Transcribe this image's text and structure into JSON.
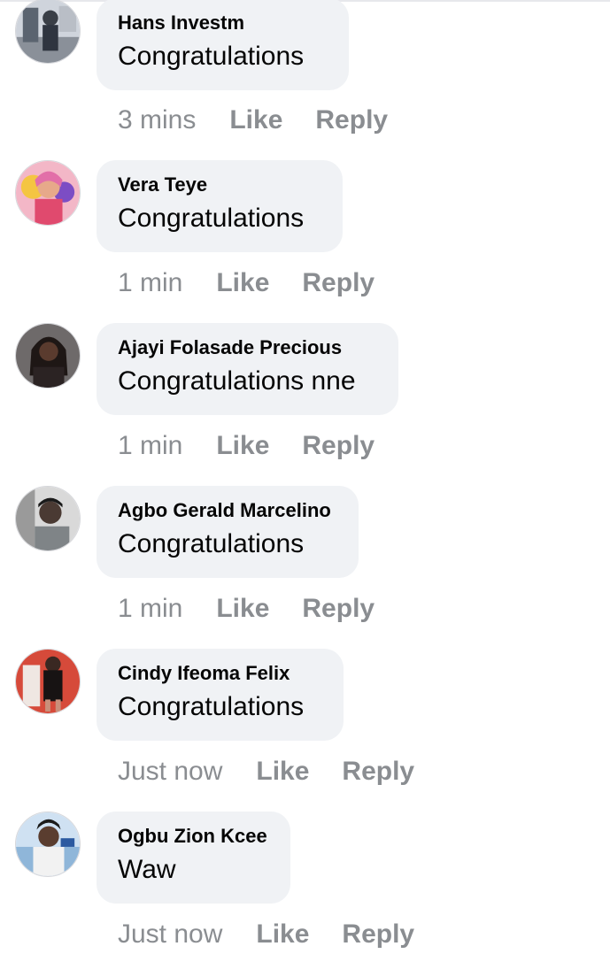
{
  "comments": [
    {
      "author": "Hans Investm",
      "text": "Congratulations",
      "time": "3 mins",
      "like": "Like",
      "reply": "Reply"
    },
    {
      "author": "Vera Teye",
      "text": "Congratulations",
      "time": "1 min",
      "like": "Like",
      "reply": "Reply"
    },
    {
      "author": "Ajayi Folasade Precious",
      "text": "Congratulations nne",
      "time": "1 min",
      "like": "Like",
      "reply": "Reply"
    },
    {
      "author": "Agbo Gerald Marcelino",
      "text": "Congratulations",
      "time": "1 min",
      "like": "Like",
      "reply": "Reply"
    },
    {
      "author": "Cindy Ifeoma Felix",
      "text": "Congratulations",
      "time": "Just now",
      "like": "Like",
      "reply": "Reply"
    },
    {
      "author": "Ogbu Zion Kcee",
      "text": "Waw",
      "time": "Just now",
      "like": "Like",
      "reply": "Reply"
    }
  ],
  "colors": {
    "bubble": "#f0f2f5",
    "meta_text": "#8a8d91",
    "primary_text": "#050505"
  }
}
